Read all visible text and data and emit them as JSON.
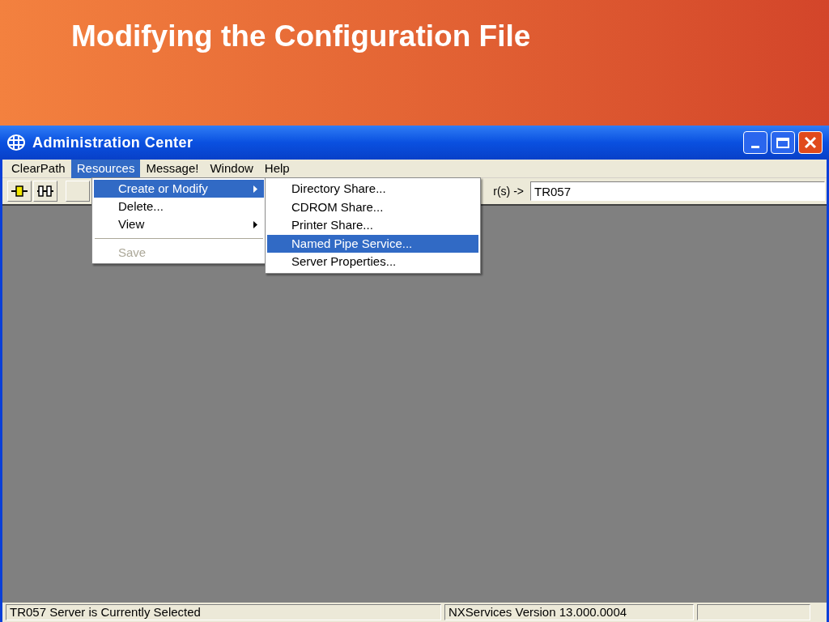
{
  "slide": {
    "title": "Modifying the Configuration File"
  },
  "window": {
    "title": "Administration Center"
  },
  "menu_bar": [
    {
      "label": "ClearPath",
      "selected": false
    },
    {
      "label": "Resources",
      "selected": true
    },
    {
      "label": "Message!",
      "selected": false
    },
    {
      "label": "Window",
      "selected": false
    },
    {
      "label": "Help",
      "selected": false
    }
  ],
  "toolbar": {
    "label": "r(s) ->",
    "server_field": {
      "value": "TR057"
    }
  },
  "resources_menu": [
    {
      "kind": "item",
      "label": "Create or Modify",
      "submenu": true,
      "selected": true,
      "disabled": false
    },
    {
      "kind": "item",
      "label": "Delete...",
      "submenu": false,
      "selected": false,
      "disabled": false
    },
    {
      "kind": "item",
      "label": "View",
      "submenu": true,
      "selected": false,
      "disabled": false
    },
    {
      "kind": "separator"
    },
    {
      "kind": "item",
      "label": "Save",
      "submenu": false,
      "selected": false,
      "disabled": true
    }
  ],
  "create_submenu": [
    {
      "label": "Directory Share...",
      "selected": false
    },
    {
      "label": "CDROM Share...",
      "selected": false
    },
    {
      "label": "Printer Share...",
      "selected": false
    },
    {
      "label": "Named Pipe Service...",
      "selected": true
    },
    {
      "label": "Server Properties...",
      "selected": false
    }
  ],
  "status_bar": [
    "TR057 Server is Currently Selected",
    "NXServices Version 13.000.0004"
  ]
}
